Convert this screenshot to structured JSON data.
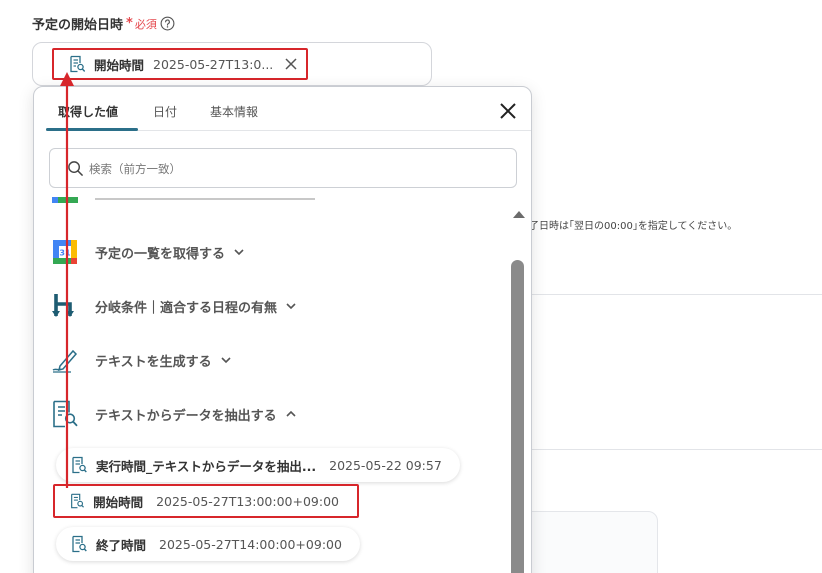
{
  "field": {
    "label": "予定の開始日時",
    "required_star": "*",
    "required_text": "必須",
    "selected_chip": {
      "label": "開始時間",
      "value": "2025-05-27T13:0..."
    }
  },
  "background": {
    "hint": "了日時は｢翌日の00:00｣を指定してください。"
  },
  "dropdown": {
    "tabs": [
      {
        "label": "取得した値",
        "active": true
      },
      {
        "label": "日付",
        "active": false
      },
      {
        "label": "基本情報",
        "active": false
      }
    ],
    "search_placeholder": "検索（前方一致）",
    "sections": [
      {
        "label": "予定の一覧を取得する",
        "icon": "google-calendar-icon",
        "expanded": false
      },
      {
        "label": "分岐条件｜適合する日程の有無",
        "icon": "branch-icon",
        "expanded": false
      },
      {
        "label": "テキストを生成する",
        "icon": "pen-icon",
        "expanded": false
      },
      {
        "label": "テキストからデータを抽出する",
        "icon": "document-search-icon",
        "expanded": true
      }
    ],
    "items": [
      {
        "label": "実行時間_テキストからデータを抽出...",
        "value": "2025-05-22 09:57"
      },
      {
        "label": "開始時間",
        "value": "2025-05-27T13:00:00+09:00",
        "highlighted": true
      },
      {
        "label": "終了時間",
        "value": "2025-05-27T14:00:00+09:00"
      }
    ]
  },
  "colors": {
    "accent_teal": "#2b6f89",
    "highlight_red": "#d7262b",
    "required_red": "#e5484d"
  }
}
